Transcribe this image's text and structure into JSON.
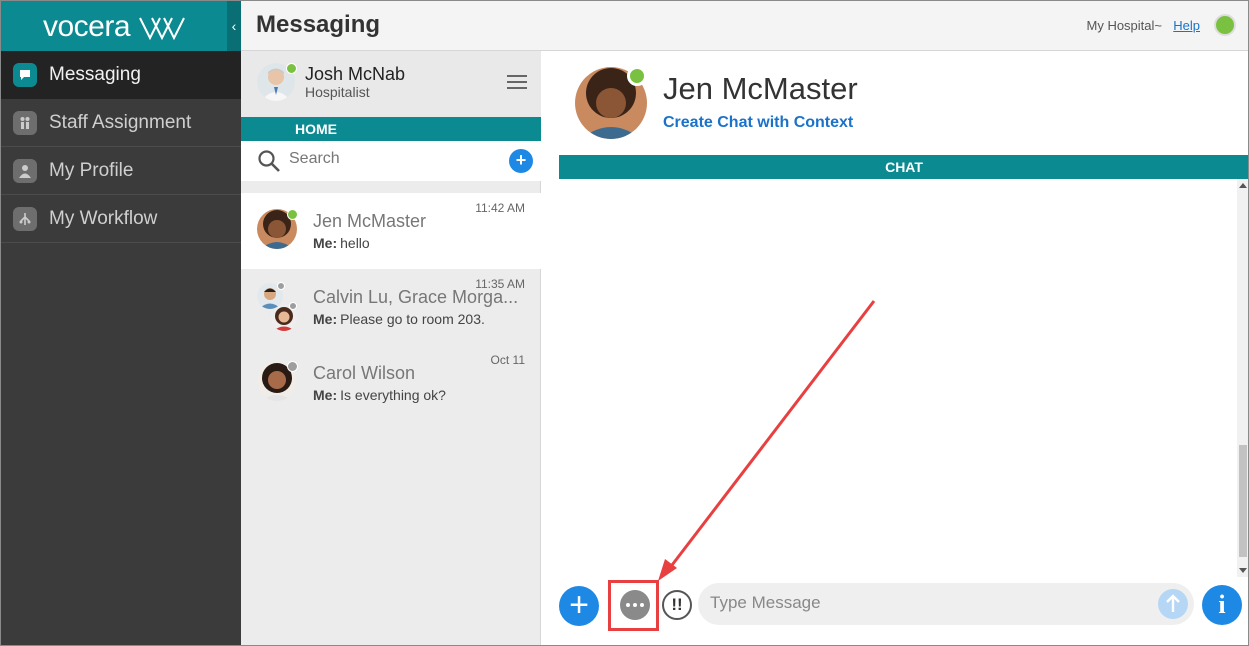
{
  "brand": {
    "logo_text": "vocera",
    "accent": "#0c8a91"
  },
  "nav": {
    "collapse_icon": "chevron-left-icon",
    "items": [
      {
        "label": "Messaging",
        "icon": "chat-bubble-icon",
        "active": true
      },
      {
        "label": "Staff Assignment",
        "icon": "staff-icon",
        "active": false
      },
      {
        "label": "My Profile",
        "icon": "person-icon",
        "active": false
      },
      {
        "label": "My Workflow",
        "icon": "workflow-icon",
        "active": false
      }
    ]
  },
  "header": {
    "title": "Messaging",
    "hospital": "My Hospital~",
    "help": "Help",
    "status_color": "#7ac142"
  },
  "me": {
    "name": "Josh McNab",
    "role": "Hospitalist",
    "presence_color": "#7ac142"
  },
  "list": {
    "home_label": "HOME",
    "search_placeholder": "Search",
    "conversations": [
      {
        "name": "Jen McMaster",
        "sender": "Me:",
        "message": "hello",
        "time": "11:42 AM",
        "selected": true,
        "presence": "#7ac142"
      },
      {
        "name": "Calvin Lu, Grace Morga...",
        "sender": "Me:",
        "message": "Please go to room 203.",
        "time": "11:35 AM",
        "selected": false,
        "presence": "#9e9e9e"
      },
      {
        "name": "Carol Wilson",
        "sender": "Me:",
        "message": "Is everything ok?",
        "time": "Oct 11",
        "selected": false,
        "presence": "#9e9e9e"
      }
    ]
  },
  "chat": {
    "contact_name": "Jen McMaster",
    "context_link": "Create Chat with Context",
    "bar_label": "CHAT",
    "input_placeholder": "Type Message",
    "urgent_label": "!!",
    "add_label": "+",
    "info_label": "i",
    "presence_color": "#7ac142"
  },
  "annotation": {
    "color": "#e84040",
    "target": "more-options-button"
  }
}
